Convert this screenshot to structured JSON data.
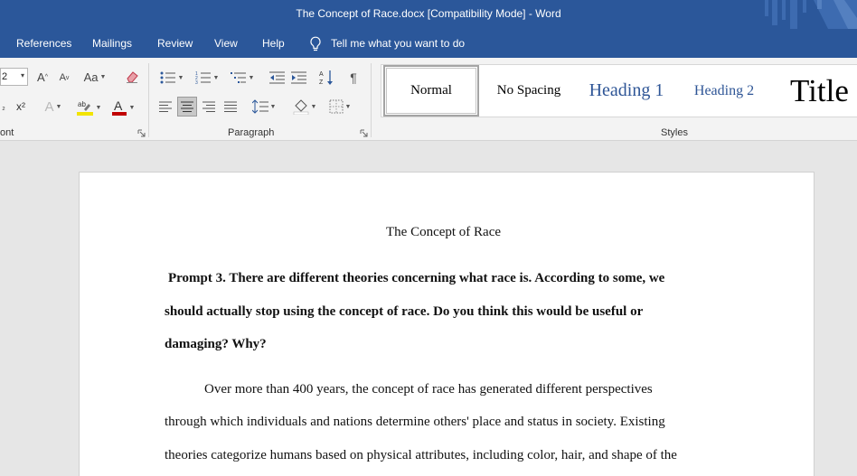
{
  "window": {
    "title": "The Concept of Race.docx [Compatibility Mode]  -  Word"
  },
  "tabs": [
    {
      "label": "References"
    },
    {
      "label": "Mailings"
    },
    {
      "label": "Review"
    },
    {
      "label": "View"
    },
    {
      "label": "Help"
    }
  ],
  "tell_me": {
    "icon": "lightbulb-icon",
    "label": "Tell me what you want to do"
  },
  "ribbon": {
    "font": {
      "label": "ont",
      "size_value": "2",
      "case_label": "Aa"
    },
    "paragraph": {
      "label": "Paragraph"
    },
    "styles": {
      "label": "Styles",
      "items": [
        {
          "label": "Normal",
          "selected": true
        },
        {
          "label": "No Spacing"
        },
        {
          "label": "Heading 1"
        },
        {
          "label": "Heading 2"
        },
        {
          "label": "Title"
        }
      ]
    },
    "colors": {
      "highlight": "#f2e400",
      "font_color": "#c00000",
      "accent": "#2b579a",
      "heading": "#2e5596"
    }
  },
  "document": {
    "title": "The Concept of Race",
    "prompt_lines": [
      "Prompt 3. There are different theories concerning what race is. According to some, we",
      "should actually stop using the concept of race. Do you think this would be useful or",
      "damaging? Why?"
    ],
    "body_lines": [
      "Over more than 400 years, the concept of race has generated different perspectives",
      "through which individuals and nations determine others' place and status in society. Existing",
      "theories categorize humans based on physical attributes, including color, hair, and shape of the"
    ]
  }
}
